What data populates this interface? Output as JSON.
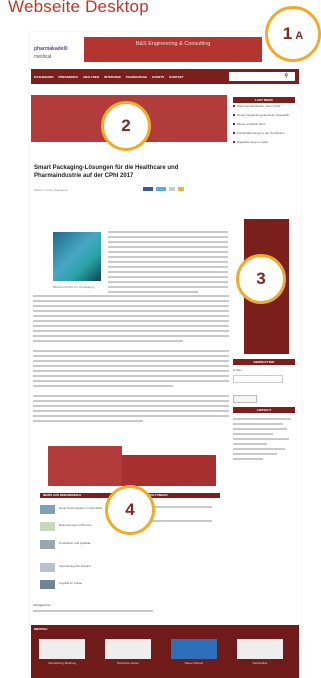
{
  "heading": "Webseite Desktop",
  "logo": {
    "line1": "pharmakadelli",
    "line2": "medical"
  },
  "top_banner": {
    "text": "B&S Engineering & Consulting"
  },
  "nav": {
    "items": [
      "DASHBOARD",
      "PRESSEINFO",
      "ANALYSEN",
      "INTERVIEW",
      "PHARMAPAGE",
      "EVENTS",
      "KONTAKT"
    ],
    "search_placeholder": "Suche"
  },
  "badges": {
    "b1_num": "1",
    "b1_sub": "A",
    "b2": "2",
    "b3": "3",
    "b4": "4"
  },
  "sidebar": {
    "head": "LAST NEWS",
    "items": [
      "Pharma-Lieferketten unter Druck",
      "Neues Verpackungskonzept vorgestellt",
      "Messe-Ausblick 2017",
      "Fachkräftemangel in der Produktion",
      "Digitalisierung im Labor"
    ],
    "newsletter_head": "NEWSLETTER",
    "newsletter_text": "E-Mail",
    "more_head": "CONTACT"
  },
  "article": {
    "title": "Smart Packaging-Lösungen für die Healthcare und Pharmaindustrie auf der CPhI 2017",
    "meta": "Datum | Autor | Kategorie",
    "caption": "Bildunterschrift zur Verpackung"
  },
  "sections": {
    "news_head": "NEWS AUS DEM BEREICH",
    "events_head": "VERANSTALTUNGEN"
  },
  "news_items": [
    "Neue Technologien im Überblick",
    "Branchenreport Pharma",
    "Produktion und Qualität",
    "Verpackung der Zukunft",
    "Logistik im Fokus"
  ],
  "tags_label": "Schlagwörter:",
  "footer": {
    "head": "MEDITAG",
    "captions": [
      "Verpackung Meldung",
      "Branchen-News",
      "Neuer Partner",
      "Fachartikel"
    ]
  }
}
